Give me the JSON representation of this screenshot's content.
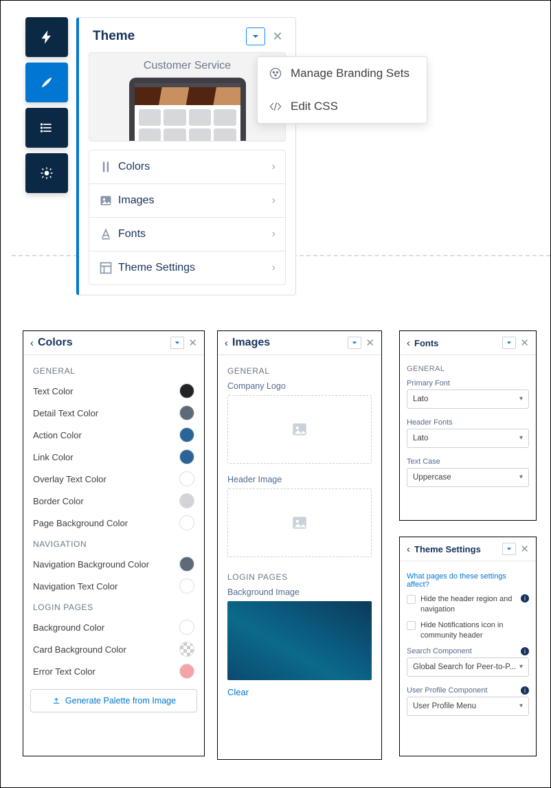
{
  "theme": {
    "title": "Theme",
    "preview_label": "Customer Service",
    "rows": [
      {
        "label": "Colors"
      },
      {
        "label": "Images"
      },
      {
        "label": "Fonts"
      },
      {
        "label": "Theme Settings"
      }
    ]
  },
  "flyout": {
    "manage": "Manage Branding Sets",
    "edit_css": "Edit CSS"
  },
  "colors": {
    "title": "Colors",
    "sec_general": "GENERAL",
    "sec_nav": "NAVIGATION",
    "sec_login": "LOGIN PAGES",
    "rows_general": [
      {
        "label": "Text Color",
        "color": "#222426"
      },
      {
        "label": "Detail Text Color",
        "color": "#5c6b77"
      },
      {
        "label": "Action Color",
        "color": "#2a6496"
      },
      {
        "label": "Link Color",
        "color": "#2a6496"
      },
      {
        "label": "Overlay Text Color",
        "color": "#ffffff"
      },
      {
        "label": "Border Color",
        "color": "#d4d4d8"
      },
      {
        "label": "Page Background Color",
        "color": "#ffffff"
      }
    ],
    "rows_nav": [
      {
        "label": "Navigation Background Color",
        "color": "#5c6b77"
      },
      {
        "label": "Navigation Text Color",
        "color": "#ffffff"
      }
    ],
    "rows_login": [
      {
        "label": "Background Color",
        "color": "#ffffff"
      },
      {
        "label": "Card Background Color",
        "color": "transparent"
      },
      {
        "label": "Error Text Color",
        "color": "#f6a3a3"
      }
    ],
    "generate": "Generate Palette from Image"
  },
  "images": {
    "title": "Images",
    "sec_general": "GENERAL",
    "company_logo": "Company Logo",
    "header_image": "Header Image",
    "sec_login": "LOGIN PAGES",
    "bg_image": "Background Image",
    "clear": "Clear"
  },
  "fonts": {
    "title": "Fonts",
    "sec_general": "GENERAL",
    "primary_label": "Primary Font",
    "primary_value": "Lato",
    "header_label": "Header Fonts",
    "header_value": "Lato",
    "case_label": "Text Case",
    "case_value": "Uppercase"
  },
  "settings": {
    "title": "Theme Settings",
    "link_affect": "What pages do these settings affect?",
    "chk_hide_header": "Hide the header region and navigation",
    "chk_hide_notif": "Hide Notifications icon in community header",
    "search_label": "Search Component",
    "search_value": "Global Search for Peer-to-P...",
    "profile_label": "User Profile Component",
    "profile_value": "User Profile Menu"
  }
}
